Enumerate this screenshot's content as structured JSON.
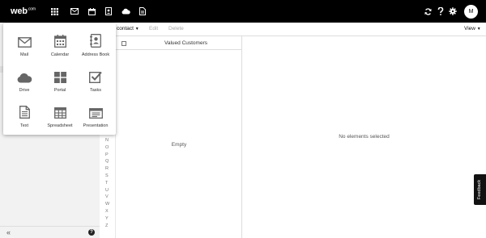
{
  "brand": {
    "logo_text": "web",
    "logo_suffix": ".com"
  },
  "topbar": {
    "left_icons": [
      "apps-grid-icon",
      "mail-icon",
      "calendar-icon",
      "address-book-icon",
      "cloud-drive-icon",
      "document-icon"
    ],
    "right_icons": [
      "sync-icon",
      "help-icon",
      "settings-icon"
    ],
    "avatar_initial": "M"
  },
  "toolbar": {
    "contact_label": "contact",
    "edit_label": "Edit",
    "delete_label": "Delete",
    "view_label": "View"
  },
  "apps_menu": {
    "items": [
      {
        "label": "Mail",
        "icon": "mail-icon"
      },
      {
        "label": "Calendar",
        "icon": "calendar-icon"
      },
      {
        "label": "Address Book",
        "icon": "address-book-icon"
      },
      {
        "label": "Drive",
        "icon": "cloud-drive-icon"
      },
      {
        "label": "Portal",
        "icon": "portal-icon"
      },
      {
        "label": "Tasks",
        "icon": "tasks-icon"
      },
      {
        "label": "Text",
        "icon": "text-document-icon"
      },
      {
        "label": "Spreadsheet",
        "icon": "spreadsheet-icon"
      },
      {
        "label": "Presentation",
        "icon": "presentation-icon"
      }
    ]
  },
  "alphabet": [
    "N",
    "O",
    "P",
    "Q",
    "R",
    "S",
    "T",
    "U",
    "V",
    "W",
    "X",
    "Y",
    "Z"
  ],
  "contact_list": {
    "group_title": "Valued Customers",
    "empty_text": "Empty"
  },
  "detail": {
    "empty_text": "No elements selected"
  },
  "sidebar": {
    "collapse_label": "«",
    "help_label": "?"
  },
  "feedback": {
    "label": "Feedback"
  },
  "colors": {
    "topbar": "#000000",
    "sidebar": "#f2f2f2",
    "icon_grey": "#666666"
  }
}
